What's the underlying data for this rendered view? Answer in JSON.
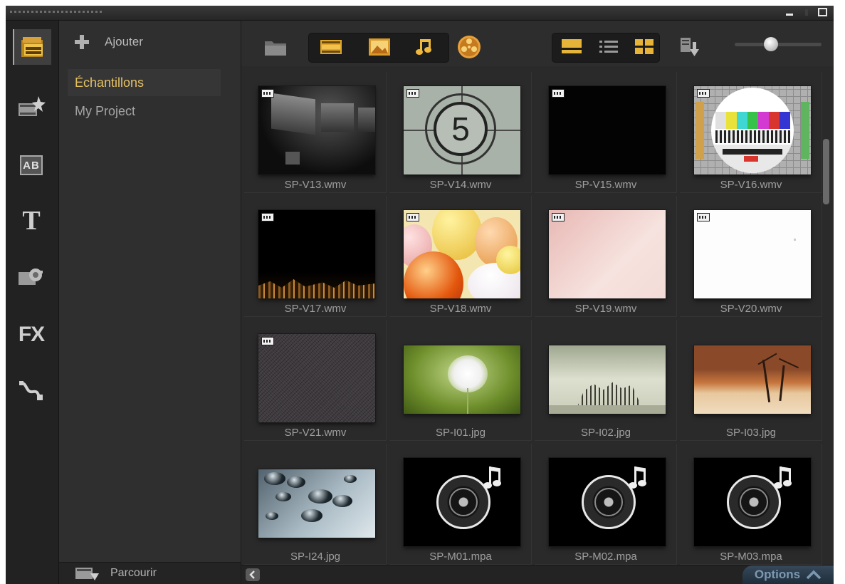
{
  "library": {
    "add_label": "Ajouter",
    "items": [
      {
        "label": "Échantillons",
        "selected": true
      },
      {
        "label": "My Project",
        "selected": false
      }
    ],
    "browse_label": "Parcourir"
  },
  "sidebar": {
    "items": [
      {
        "icon": "media-library-icon",
        "active": true
      },
      {
        "icon": "instant-project-icon",
        "active": false
      },
      {
        "icon": "transition-icon",
        "active": false
      },
      {
        "icon": "title-icon",
        "active": false
      },
      {
        "icon": "graphics-icon",
        "active": false
      },
      {
        "icon": "filter-icon",
        "active": false
      },
      {
        "icon": "path-icon",
        "active": false
      }
    ],
    "fx_label": "FX",
    "ab_label": "AB",
    "t_label": "T"
  },
  "toolbar": {
    "zoom_level": 0.4
  },
  "media": [
    {
      "name": "SP-V13.wmv",
      "type": "video",
      "art": "screens"
    },
    {
      "name": "SP-V14.wmv",
      "type": "video",
      "art": "countdown",
      "text": "5"
    },
    {
      "name": "SP-V15.wmv",
      "type": "video",
      "art": "black"
    },
    {
      "name": "SP-V16.wmv",
      "type": "video",
      "art": "testcard"
    },
    {
      "name": "SP-V17.wmv",
      "type": "video",
      "art": "city"
    },
    {
      "name": "SP-V18.wmv",
      "type": "video",
      "art": "balloons"
    },
    {
      "name": "SP-V19.wmv",
      "type": "video",
      "art": "pink"
    },
    {
      "name": "SP-V20.wmv",
      "type": "video",
      "art": "white"
    },
    {
      "name": "SP-V21.wmv",
      "type": "video",
      "art": "noise"
    },
    {
      "name": "SP-I01.jpg",
      "type": "image",
      "art": "dandelion"
    },
    {
      "name": "SP-I02.jpg",
      "type": "image",
      "art": "trees"
    },
    {
      "name": "SP-I03.jpg",
      "type": "image",
      "art": "desert"
    },
    {
      "name": "SP-I24.jpg",
      "type": "image",
      "art": "drops"
    },
    {
      "name": "SP-M01.mpa",
      "type": "audio",
      "art": "disc"
    },
    {
      "name": "SP-M02.mpa",
      "type": "audio",
      "art": "disc"
    },
    {
      "name": "SP-M03.mpa",
      "type": "audio",
      "art": "disc"
    }
  ],
  "footer": {
    "options_label": "Options"
  },
  "colors": {
    "accent": "#e6c062",
    "panel": "#2f2f2f",
    "options": "#7b98b2"
  }
}
